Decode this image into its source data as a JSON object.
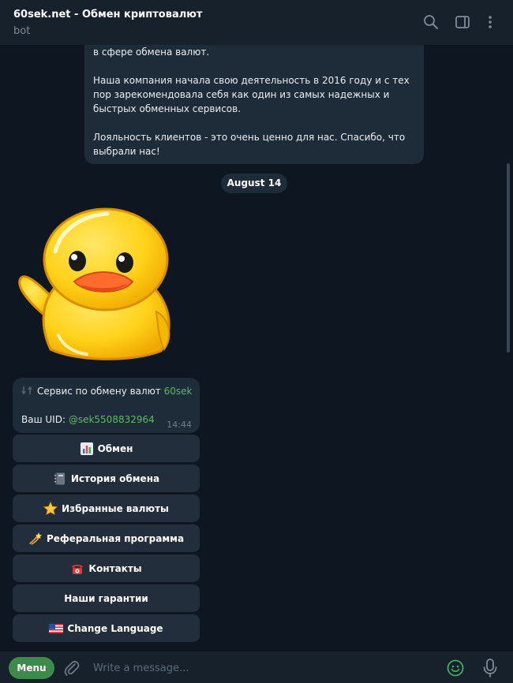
{
  "header": {
    "title": "60sek.net - Обмен криптовалют",
    "subtitle": "bot",
    "icons": [
      "search-icon",
      "side-panel-icon",
      "more-vertical-icon"
    ]
  },
  "messages": {
    "top": {
      "p1": "в сфере обмена валют.",
      "p2": "Наша компания начала свою деятельность в 2016 году и с тех пор зарекомендовала себя как один из самых надежных и быстрых обменных сервисов.",
      "p3": "Лояльность клиентов - это очень ценно для нас. Спасибо, что выбрали нас!"
    },
    "date": "August 14",
    "main": {
      "text1": "Сервис по обмену валют",
      "link1": "60sek",
      "uid_label": "Ваш UID:",
      "uid_value": "@sek5508832964",
      "time": "14:44"
    }
  },
  "keyboard": {
    "buttons": [
      {
        "label": "Обмен",
        "icon": "bar-chart-emoji"
      },
      {
        "label": "История обмена",
        "icon": "notebook-emoji"
      },
      {
        "label": "Избранные валюты",
        "icon": "star-emoji"
      },
      {
        "label": "Реферальная программа",
        "icon": "dizzy-emoji"
      },
      {
        "label": "Контакты",
        "icon": "telephone-emoji"
      },
      {
        "label": "Наши гарантии",
        "icon": ""
      },
      {
        "label": "Change Language",
        "icon": "us-flag-emoji"
      }
    ]
  },
  "composer": {
    "menu_label": "Menu",
    "placeholder": "Write a message..."
  },
  "colors": {
    "background": "#0e1621",
    "header": "#17212b",
    "bubble": "#1e2c3a",
    "button": "#232e3c",
    "link": "#5dbb5d",
    "menu_button": "#3d8b4a"
  }
}
